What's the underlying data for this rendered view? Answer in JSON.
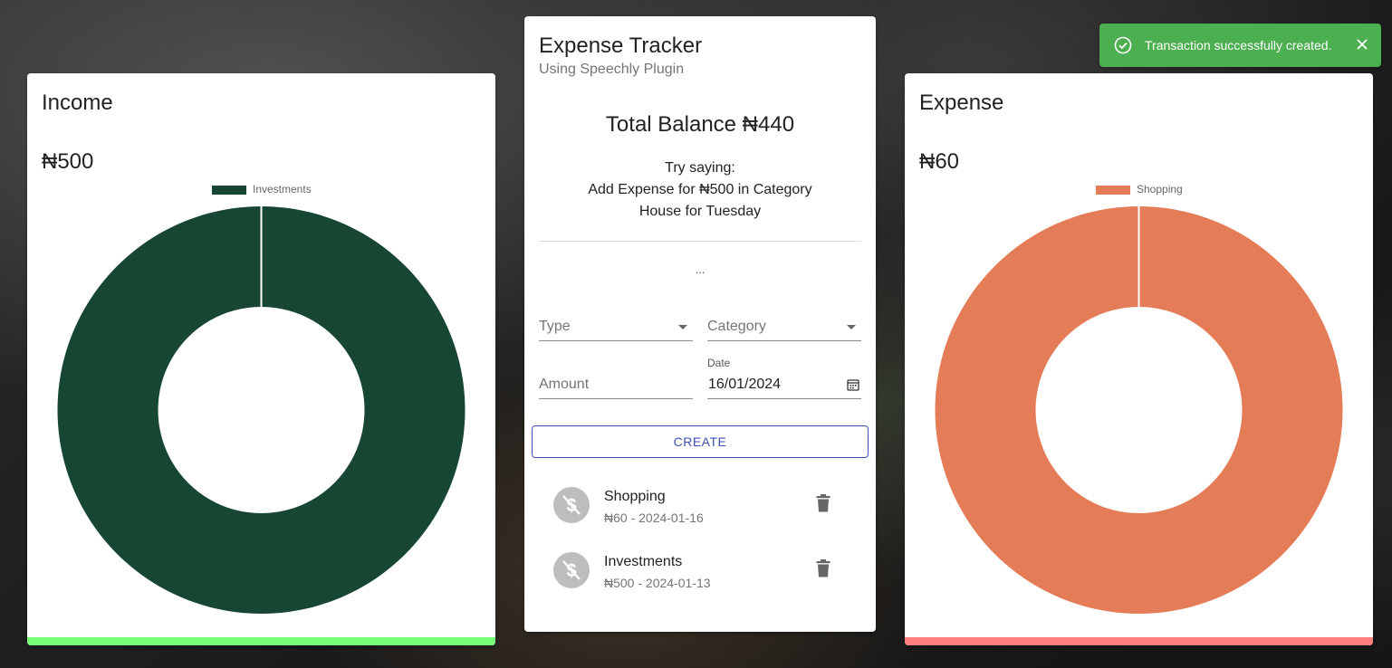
{
  "income": {
    "title": "Income",
    "amount": "₦500",
    "bar_color": "#77ff77"
  },
  "expense": {
    "title": "Expense",
    "amount": "₦60",
    "bar_color": "#ff7f7f"
  },
  "chart_data": [
    {
      "type": "pie",
      "categories": [
        "Investments"
      ],
      "values": [
        500
      ],
      "colors": [
        "#174633"
      ],
      "legend": "top"
    },
    {
      "type": "pie",
      "categories": [
        "Shopping"
      ],
      "values": [
        60
      ],
      "colors": [
        "#e57c58"
      ],
      "legend": "top"
    }
  ],
  "main": {
    "title": "Expense Tracker",
    "subtitle": "Using Speechly Plugin",
    "balance": "Total Balance ₦440",
    "hint_line1": "Try saying:",
    "hint_line2": "Add Expense for ₦500 in Category",
    "hint_line3": "House for Tuesday",
    "dots": "...",
    "form": {
      "type_placeholder": "Type",
      "category_placeholder": "Category",
      "amount_placeholder": "Amount",
      "date_label": "Date",
      "date_value": "16/01/2024",
      "create_label": "CREATE"
    },
    "transactions": [
      {
        "name": "Shopping",
        "meta": "₦60 - 2024-01-16"
      },
      {
        "name": "Investments",
        "meta": "₦500 - 2024-01-13"
      }
    ]
  },
  "toast": {
    "message": "Transaction successfully created."
  }
}
